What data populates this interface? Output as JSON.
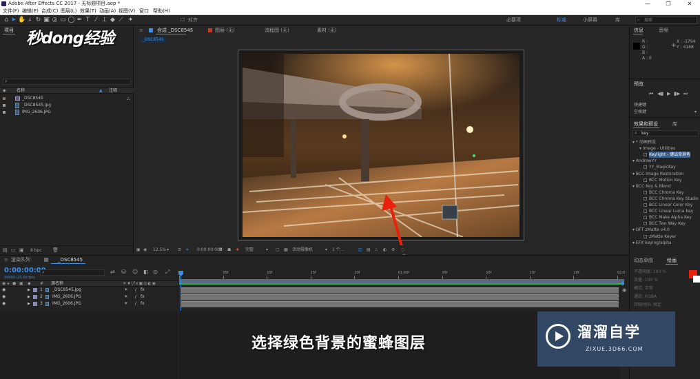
{
  "window": {
    "title": "Adobe After Effects CC 2017 - 无标题项目.aep *",
    "controls": [
      "—",
      "❐",
      "✕"
    ]
  },
  "menu": [
    "文件(F)",
    "编辑(E)",
    "合成(C)",
    "图层(L)",
    "效果(T)",
    "动画(A)",
    "视图(V)",
    "窗口",
    "帮助(H)"
  ],
  "toolbar": {
    "snap_label": "对齐",
    "workspaces": [
      "必要项",
      "标准",
      "小屏幕",
      "库"
    ],
    "active_workspace": "标准",
    "search_placeholder": "搜索"
  },
  "logo_text": "秒dong经验",
  "project": {
    "tab": "项目",
    "columns": {
      "name": "名称",
      "comment": "注释"
    },
    "items": [
      {
        "name": "_DSC8545",
        "type": "comp"
      },
      {
        "name": "_DSC8545.jpg",
        "type": "file"
      },
      {
        "name": "IMG_2606.JPG",
        "type": "file"
      }
    ],
    "bpc": "8 bpc"
  },
  "viewer": {
    "tabs": [
      {
        "label": "合成 _DSC8545",
        "active": true
      },
      {
        "label": "图层 (无)",
        "active": false
      },
      {
        "label": "流程图 (无)",
        "active": false
      },
      {
        "label": "素材 (无)",
        "active": false
      }
    ],
    "breadcrumb": "_DSC8545",
    "zoom": "12.5%",
    "timecode": "0:00:00:00",
    "resolution": "完整",
    "camera": "活动摄像机",
    "views": "1 个..."
  },
  "info_panel": {
    "tabs": [
      "信息",
      "音频"
    ],
    "channels": [
      "R :",
      "G :",
      "B :",
      "A : 0"
    ],
    "x_coord": "X : -1794",
    "y_coord": "Y : 4168"
  },
  "preview_panel": {
    "title": "预览",
    "shortcut_label": "快捷键",
    "shortcut_value": "空格键"
  },
  "effects_panel": {
    "tabs": [
      "效果和预设",
      "库"
    ],
    "search_value": "key",
    "tree": [
      {
        "text": "▾ * 动画预设",
        "level": 0
      },
      {
        "text": "▾ Image - Utilities",
        "level": 1
      },
      {
        "text": "Keylight - 键出背景色",
        "level": 2,
        "selected": true
      },
      {
        "text": "▾ AndrewYY",
        "level": 0
      },
      {
        "text": "YY_MagicKey",
        "level": 2
      },
      {
        "text": "▾ BCC Image Restoration",
        "level": 0
      },
      {
        "text": "BCC Motion Key",
        "level": 2
      },
      {
        "text": "▾ BCC Key & Blend",
        "level": 0
      },
      {
        "text": "BCC Chroma Key",
        "level": 2
      },
      {
        "text": "BCC Chroma Key Studio",
        "level": 2
      },
      {
        "text": "BCC Linear Color Key",
        "level": 2
      },
      {
        "text": "BCC Linear Luma Key",
        "level": 2
      },
      {
        "text": "BCC Make Alpha Key",
        "level": 2
      },
      {
        "text": "BCC Two Way Key",
        "level": 2
      },
      {
        "text": "▾ DFT zMatte v4.0",
        "level": 0
      },
      {
        "text": "zMatte Keyer",
        "level": 2
      },
      {
        "text": "▾ EFX keying/alpha",
        "level": 0
      }
    ]
  },
  "timeline": {
    "tabs": [
      "渲染队列",
      "_DSC8545"
    ],
    "timecode": "0:00:00:00",
    "fps_info": "00000 (25.00 fps)",
    "column_source": "源名称",
    "ruler": [
      "0f",
      "05f",
      "10f",
      "15f",
      "20f",
      "01:00f",
      "05f",
      "10f",
      "15f",
      "20f",
      "02:0"
    ],
    "layers": [
      {
        "index": "1",
        "name": "_DSC8545.jpg"
      },
      {
        "index": "2",
        "name": "IMG_2606.JPG"
      },
      {
        "index": "3",
        "name": "IMG_2606.JPG"
      }
    ]
  },
  "properties_panel": {
    "tabs": [
      "动态草图",
      "绘画"
    ],
    "rows": [
      "不透明度: 100 %",
      "流量: 100 %",
      "模式: 正常",
      "通道: RGBA",
      "持续时间: 恒定"
    ]
  },
  "subtitle": "选择绿色背景的蜜蜂图层",
  "watermark": {
    "title": "溜溜自学",
    "url": "ZIXUE.3D66.COM"
  },
  "colors": {
    "accent": "#3a8ee6",
    "fg_swatch": "#e8200c",
    "bar": "#747474"
  }
}
